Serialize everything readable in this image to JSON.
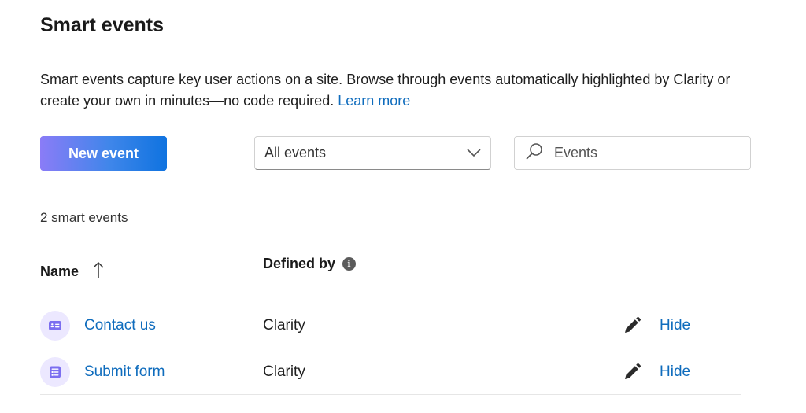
{
  "page": {
    "title": "Smart events",
    "description": "Smart events capture key user actions on a site. Browse through events automatically highlighted by Clarity or create your own in minutes—no code required.",
    "learn_more": "Learn more"
  },
  "toolbar": {
    "new_event_label": "New event",
    "filter": {
      "selected": "All events"
    },
    "search": {
      "placeholder": "Events",
      "value": ""
    }
  },
  "list": {
    "count_text": "2 smart events",
    "columns": {
      "name": "Name",
      "defined_by": "Defined by"
    },
    "sort_icon": "arrow-up-icon",
    "info_icon": "info-icon",
    "rows": [
      {
        "name": "Contact us",
        "defined_by": "Clarity",
        "icon": "contact-card-icon",
        "hide_label": "Hide"
      },
      {
        "name": "Submit form",
        "defined_by": "Clarity",
        "icon": "form-icon",
        "hide_label": "Hide"
      }
    ]
  },
  "colors": {
    "link": "#0f6cbd",
    "button_gradient_start": "#8a7cf7",
    "button_gradient_end": "#0f73e0",
    "icon_bg": "#ece8ff",
    "icon_fg": "#7b6ef0"
  }
}
